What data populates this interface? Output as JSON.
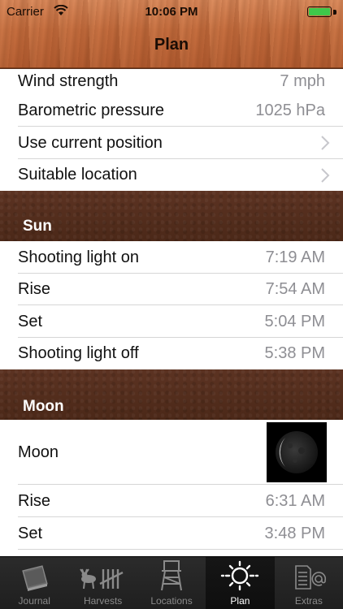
{
  "status": {
    "carrier": "Carrier",
    "time": "10:06 PM",
    "battery_level": 1.0
  },
  "nav": {
    "title": "Plan"
  },
  "settings_rows": [
    {
      "label": "Wind strength",
      "value": "7 mph"
    },
    {
      "label": "Barometric pressure",
      "value": "1025 hPa"
    },
    {
      "label": "Use current position",
      "value": ""
    },
    {
      "label": "Suitable location",
      "value": ""
    }
  ],
  "sun": {
    "title": "Sun",
    "rows": [
      {
        "label": "Shooting light on",
        "value": "7:19 AM"
      },
      {
        "label": "Rise",
        "value": "7:54 AM"
      },
      {
        "label": "Set",
        "value": "5:04 PM"
      },
      {
        "label": "Shooting light off",
        "value": "5:38 PM"
      }
    ]
  },
  "moon": {
    "title": "Moon",
    "phase_label": "Moon",
    "rows": [
      {
        "label": "Rise",
        "value": "6:31 AM"
      },
      {
        "label": "Set",
        "value": "3:48 PM"
      }
    ]
  },
  "tabs": [
    {
      "label": "Journal",
      "icon": "journal-icon",
      "active": false
    },
    {
      "label": "Harvests",
      "icon": "harvests-icon",
      "active": false
    },
    {
      "label": "Locations",
      "icon": "tower-icon",
      "active": false
    },
    {
      "label": "Plan",
      "icon": "sun-icon",
      "active": true
    },
    {
      "label": "Extras",
      "icon": "extras-icon",
      "active": false
    }
  ]
}
